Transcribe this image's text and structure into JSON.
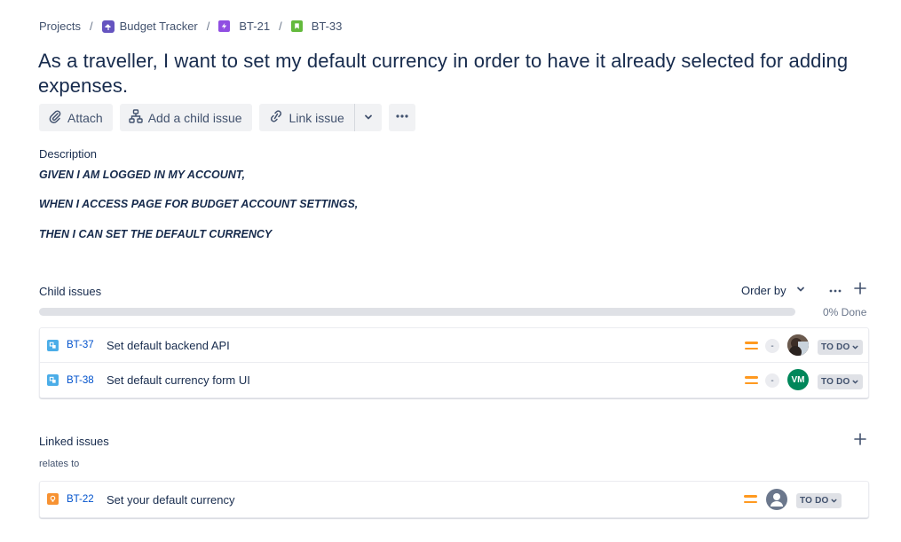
{
  "breadcrumb": {
    "items": [
      {
        "label": "Projects"
      },
      {
        "label": "Budget Tracker"
      },
      {
        "label": "BT-21"
      },
      {
        "label": "BT-33"
      }
    ],
    "separator": "/"
  },
  "issue": {
    "title": "As a traveller, I want to set my default currency in order to have it already selected for adding expenses."
  },
  "toolbar": {
    "attach_label": "Attach",
    "add_child_label": "Add a child issue",
    "link_issue_label": "Link issue"
  },
  "description": {
    "label": "Description",
    "lines": [
      "GIVEN I AM LOGGED IN MY ACCOUNT,",
      "WHEN I ACCESS PAGE FOR BUDGET ACCOUNT SETTINGS,",
      "THEN I CAN SET THE DEFAULT CURRENCY"
    ]
  },
  "child_issues": {
    "label": "Child issues",
    "order_by_label": "Order by",
    "progress_percent": 0,
    "done_text": "0% Done",
    "items": [
      {
        "key": "BT-37",
        "summary": "Set default backend API",
        "priority": "medium",
        "estimate": "-",
        "assignee": "photo",
        "status": "TO DO"
      },
      {
        "key": "BT-38",
        "summary": "Set default currency form UI",
        "priority": "medium",
        "estimate": "-",
        "assignee": "VM",
        "status": "TO DO"
      }
    ]
  },
  "linked_issues": {
    "label": "Linked issues",
    "relation": "relates to",
    "items": [
      {
        "key": "BT-22",
        "summary": "Set your default currency",
        "priority": "medium",
        "assignee": "unassigned",
        "status": "TO DO"
      }
    ]
  },
  "colors": {
    "link": "#0052cc",
    "priority_medium": "#ff991f",
    "subtask": "#4bade8",
    "story": "#63ba3c",
    "epic": "#904ee2",
    "linked_type": "#f79232",
    "avatar_vm": "#00875a"
  },
  "icons": [
    "attachment-icon",
    "hierarchy-icon",
    "link-icon",
    "chevron-down-icon",
    "more-icon",
    "plus-icon",
    "subtask-icon",
    "story-icon",
    "epic-icon",
    "priority-medium-icon",
    "user-icon"
  ]
}
